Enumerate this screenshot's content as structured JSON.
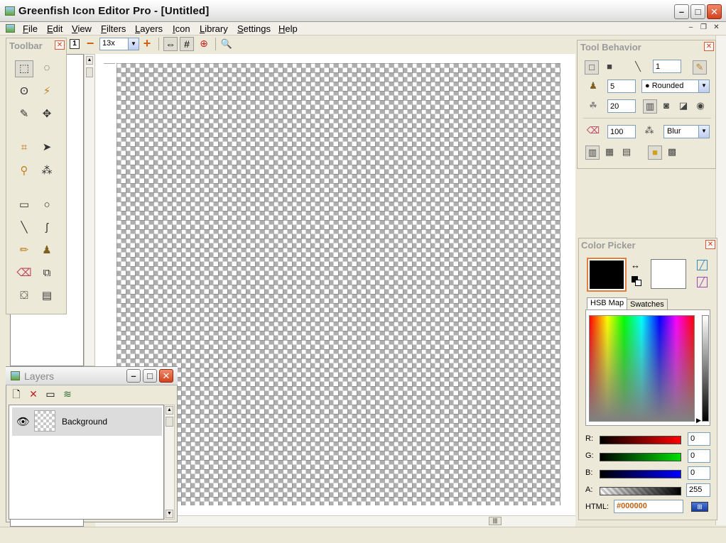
{
  "window": {
    "title": "Greenfish Icon Editor Pro - [Untitled]",
    "minimize_glyph": "–",
    "maximize_glyph": "□",
    "close_glyph": "✕"
  },
  "menu": {
    "items": [
      {
        "label": "File",
        "hotkey": "F"
      },
      {
        "label": "Edit",
        "hotkey": "E"
      },
      {
        "label": "View",
        "hotkey": "V"
      },
      {
        "label": "Filters",
        "hotkey": "F"
      },
      {
        "label": "Layers",
        "hotkey": "L"
      },
      {
        "label": "Icon",
        "hotkey": "I"
      },
      {
        "label": "Library",
        "hotkey": "L"
      },
      {
        "label": "Settings",
        "hotkey": "S"
      },
      {
        "label": "Help",
        "hotkey": "H"
      }
    ],
    "mdi_min": "–",
    "mdi_restore": "❐",
    "mdi_close": "✕"
  },
  "topbar": {
    "actual_size_label": "1",
    "zoom_out": "−",
    "zoom_value": "13x",
    "zoom_in": "+",
    "fit_icon": "⇔",
    "grid_icon": "#",
    "center_icon": "⊕",
    "search_icon": "🔍"
  },
  "toolbox": {
    "title": "Toolbar",
    "tools": [
      "rect-select",
      "ellipse-select",
      "lasso",
      "magic-wand",
      "pen-select",
      "move",
      "crop",
      "pointer",
      "eyedropper",
      "spray",
      "rectangle",
      "ellipse",
      "line",
      "curve",
      "pencil",
      "brush",
      "eraser",
      "clone",
      "fill",
      "gradient"
    ]
  },
  "tool_behavior": {
    "title": "Tool Behavior",
    "line_width": "1",
    "brush_size": "5",
    "brush_shape": "Rounded",
    "hardness": "20",
    "opacity": "100",
    "effect": "Blur"
  },
  "color_picker": {
    "title": "Color Picker",
    "tabs": [
      "HSB Map",
      "Swatches"
    ],
    "channels": [
      {
        "label": "R:",
        "value": "0",
        "color": "#ff0000"
      },
      {
        "label": "G:",
        "value": "0",
        "color": "#00cc00"
      },
      {
        "label": "B:",
        "value": "0",
        "color": "#0000ff"
      },
      {
        "label": "A:",
        "value": "255",
        "color": "#000000"
      }
    ],
    "html_label": "HTML:",
    "html_value": "#000000",
    "foreground": "#000000",
    "background": "#ffffff"
  },
  "layers": {
    "title": "Layers",
    "items": [
      {
        "name": "Background",
        "visible": true
      }
    ]
  }
}
